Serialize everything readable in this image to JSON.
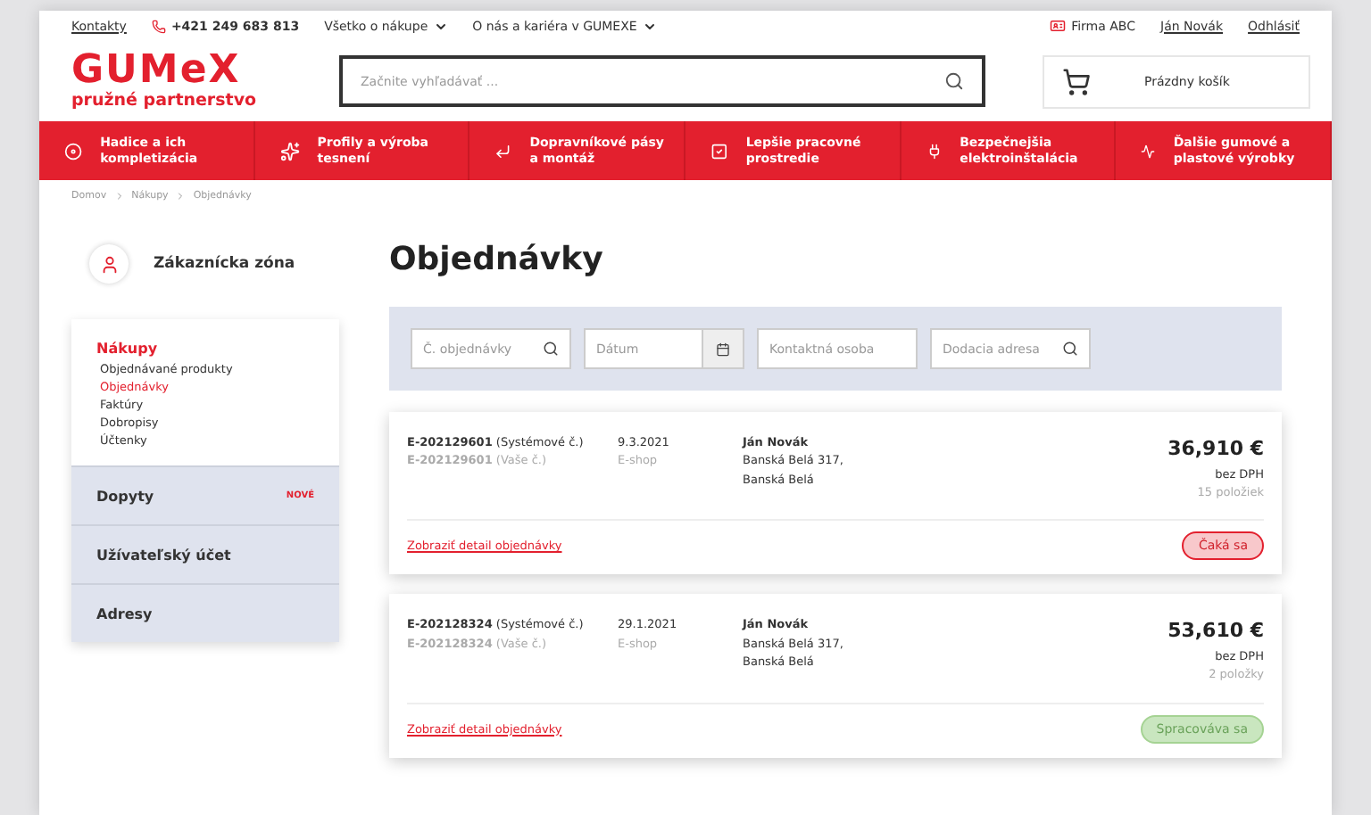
{
  "top_bar": {
    "contact_link": "Kontakty",
    "phone": "+421 249 683 813",
    "menus": [
      "Všetko o nákupe",
      "O nás a kariéra v GUMEXE"
    ],
    "company": "Firma ABC",
    "user": "Ján Novák",
    "logout": "Odhlásiť"
  },
  "header": {
    "logo": "GUMeX",
    "tagline": "pružné partnerstvo",
    "search": {
      "placeholder": "Začnite vyhľadávať ..."
    },
    "cart": "Prázdny košík"
  },
  "nav": [
    {
      "label": "Hadice a ich kompletizácia"
    },
    {
      "label": "Profily a výroba tesnení"
    },
    {
      "label": "Dopravníkové pásy a montáž"
    },
    {
      "label": "Lepšie pracovné prostredie"
    },
    {
      "label": "Bezpečnejšia elektroinštalácia"
    },
    {
      "label": "Ďalšie gumové a plastové výrobky"
    }
  ],
  "breadcrumb": [
    "Domov",
    "Nákupy",
    "Objednávky"
  ],
  "sidebar": {
    "title": "Zákaznícka zóna",
    "section": "Nákupy",
    "items": [
      {
        "label": "Objednávané produkty",
        "selected": false
      },
      {
        "label": "Objednávky",
        "selected": true
      },
      {
        "label": "Faktúry",
        "selected": false
      },
      {
        "label": "Dobropisy",
        "selected": false
      },
      {
        "label": "Účtenky",
        "selected": false
      }
    ],
    "groups": [
      {
        "label": "Dopyty",
        "badge": "NOVÉ"
      },
      {
        "label": "Užívateľský účet"
      },
      {
        "label": "Adresy"
      }
    ]
  },
  "page_title": "Objednávky",
  "filters": [
    {
      "placeholder": "Č. objednávky",
      "kind": "search"
    },
    {
      "placeholder": "Dátum",
      "kind": "date"
    },
    {
      "placeholder": "Kontaktná osoba",
      "kind": "text"
    },
    {
      "placeholder": "Dodacia adresa",
      "kind": "search"
    }
  ],
  "orders": [
    {
      "system_no": "E-202129601",
      "system_label": "(Systémové č.)",
      "your_no": "E-202129601",
      "your_label": "(Vaše č.)",
      "date": "9.3.2021",
      "channel": "E-shop",
      "contact": "Ján Novák",
      "address": [
        "Banská Belá 317,",
        "Banská Belá"
      ],
      "price": "36,910 €",
      "tax": "bez DPH",
      "items": "15 položiek",
      "link": "Zobraziť detail objednávky",
      "status": "Čaká sa",
      "kind": "waiting"
    },
    {
      "system_no": "E-202128324",
      "system_label": "(Systémové č.)",
      "your_no": "E-202128324",
      "your_label": "(Vaše č.)",
      "date": "29.1.2021",
      "channel": "E-shop",
      "contact": "Ján Novák",
      "address": [
        "Banská Belá 317,",
        "Banská Belá"
      ],
      "price": "53,610 €",
      "tax": "bez DPH",
      "items": "2 položky",
      "link": "Zobraziť detail objednávky",
      "status": "Spracováva sa",
      "kind": "processing"
    }
  ]
}
